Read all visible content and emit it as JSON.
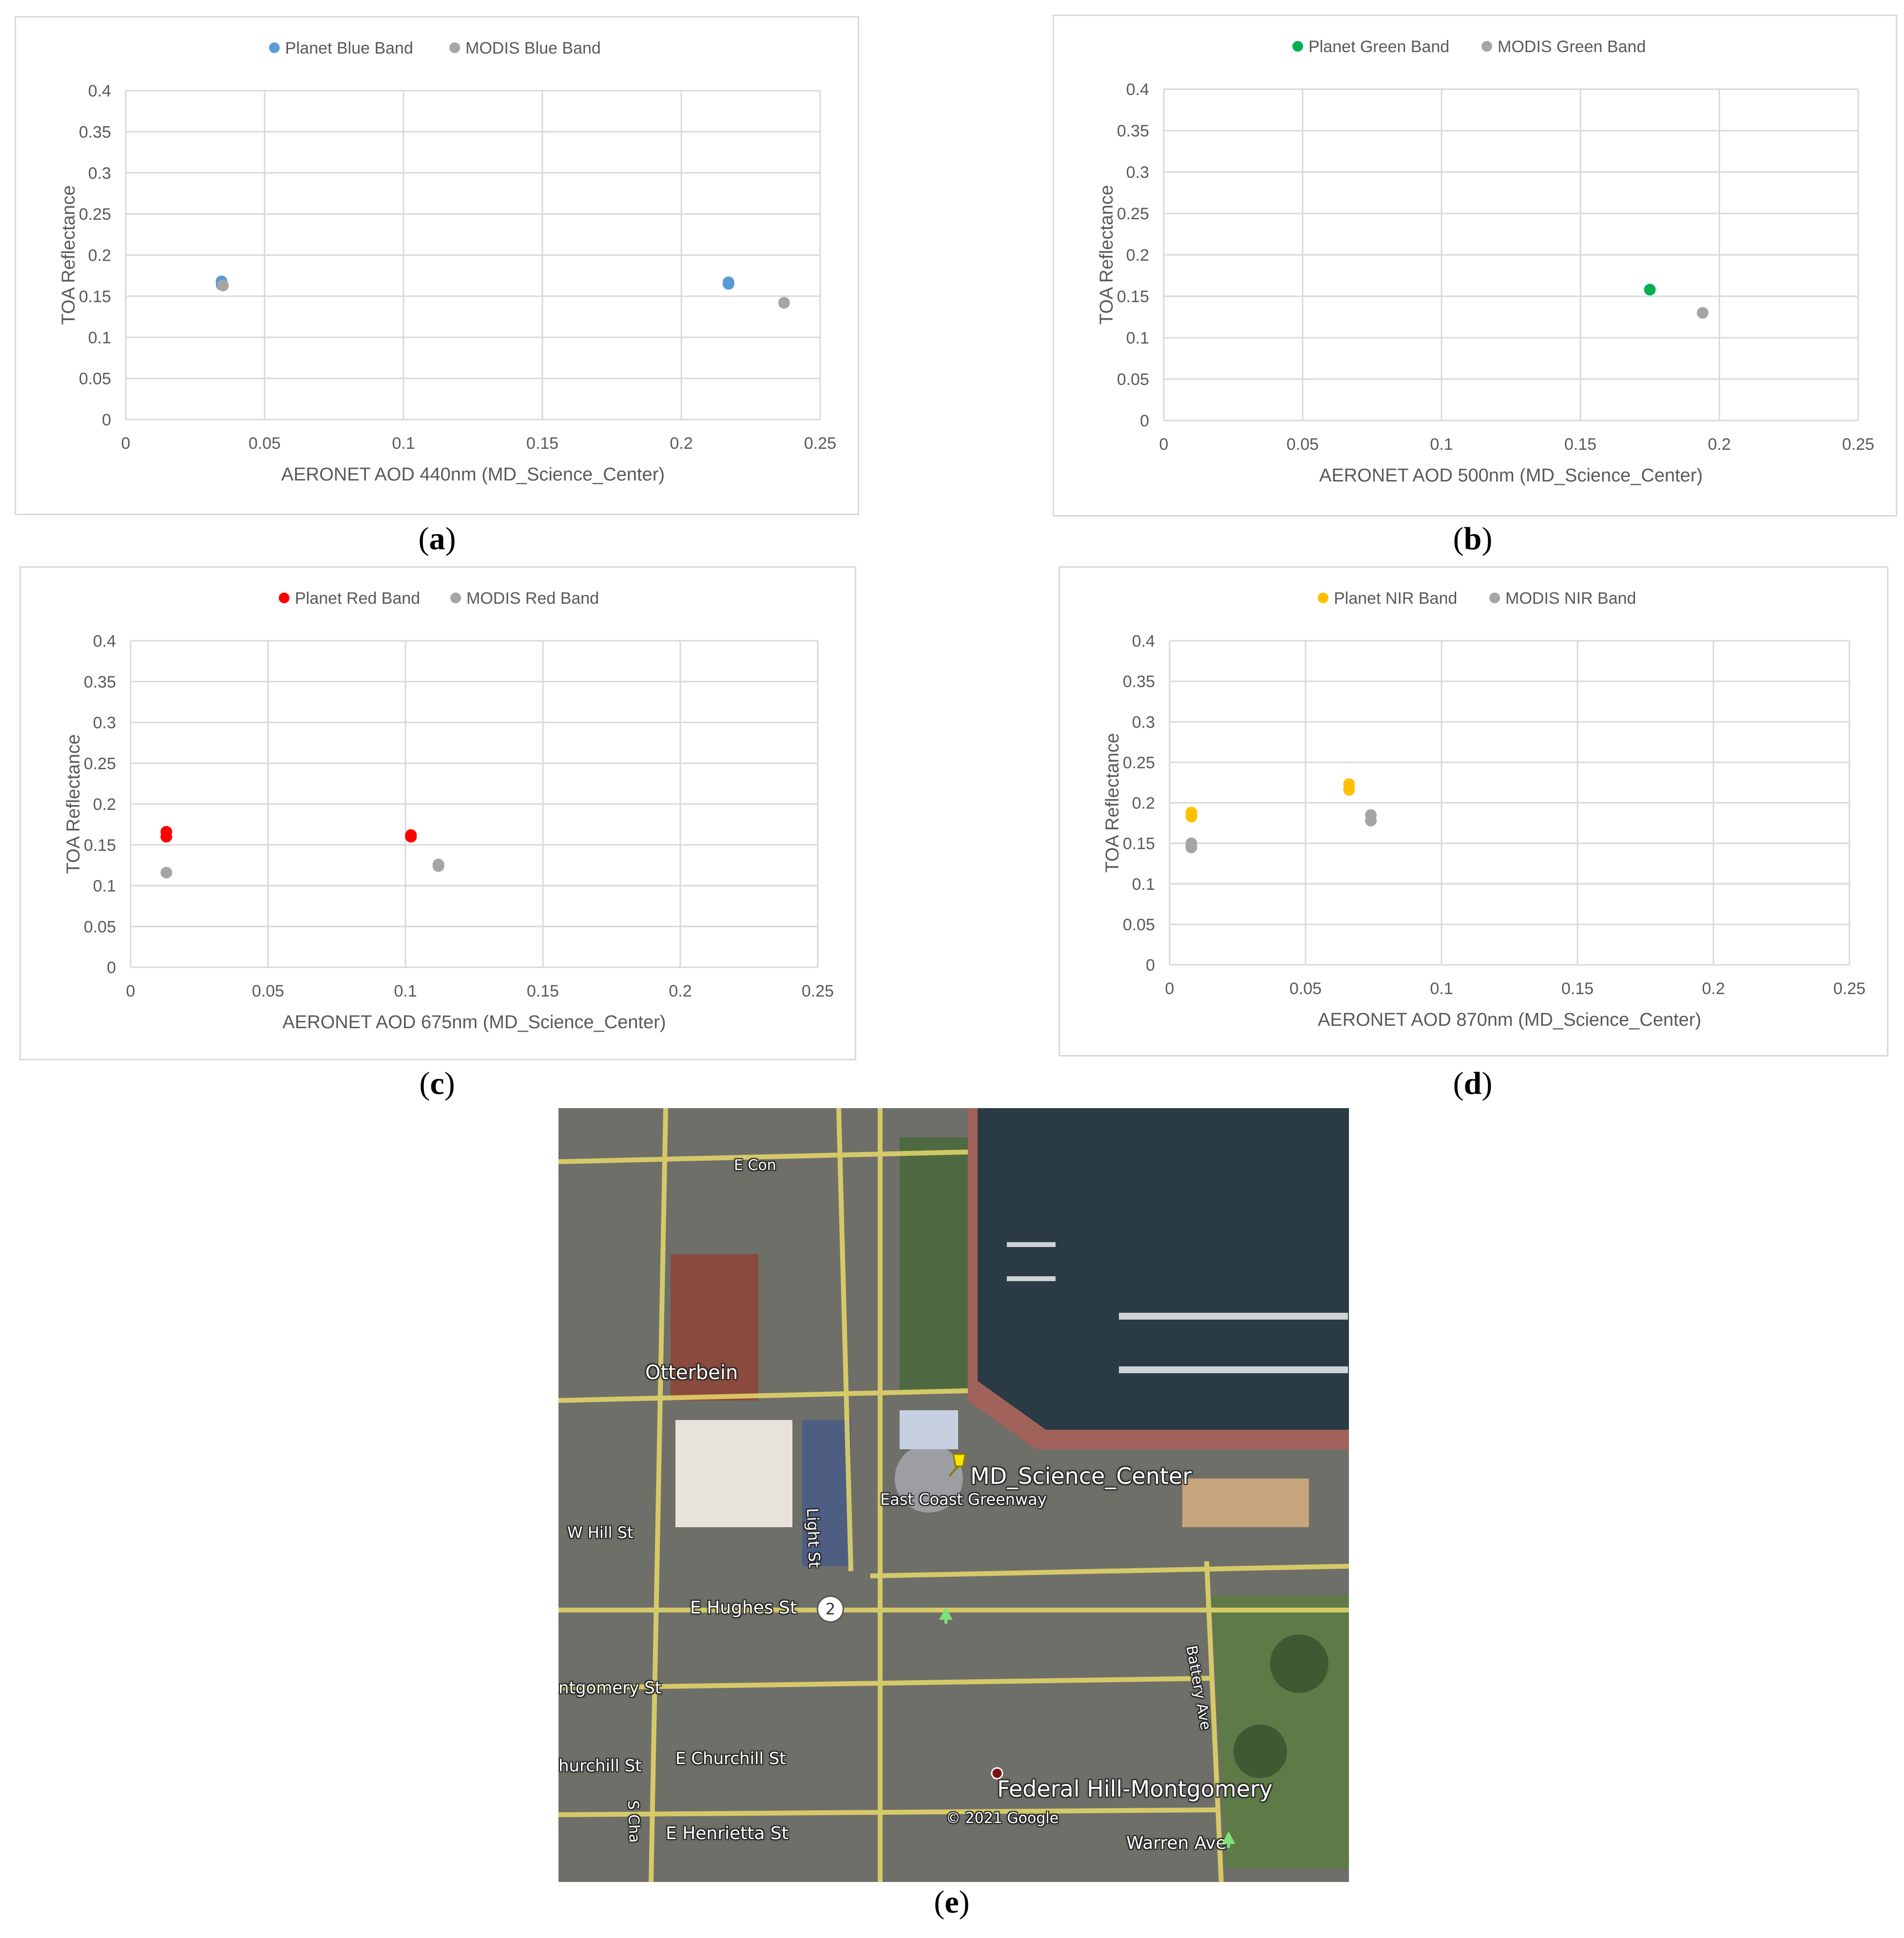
{
  "chart_data": [
    {
      "id": "a",
      "type": "scatter",
      "caption": "a",
      "xlabel": "AERONET AOD 440nm (MD_Science_Center)",
      "ylabel": "TOA Reflectance",
      "xlim": [
        0,
        0.25
      ],
      "ylim": [
        0,
        0.4
      ],
      "xticks": [
        "0",
        "0.05",
        "0.1",
        "0.15",
        "0.2",
        "0.25"
      ],
      "yticks": [
        "0",
        "0.05",
        "0.1",
        "0.15",
        "0.2",
        "0.25",
        "0.3",
        "0.35",
        "0.4"
      ],
      "legend": "top-center",
      "grid": true,
      "series": [
        {
          "name": "Planet Blue Band",
          "color": "#5b9bd5",
          "points": [
            [
              0.0345,
              0.168
            ],
            [
              0.0345,
              0.164
            ],
            [
              0.217,
              0.167
            ],
            [
              0.217,
              0.165
            ]
          ]
        },
        {
          "name": "MODIS Blue Band",
          "color": "#a5a5a5",
          "points": [
            [
              0.035,
              0.163
            ],
            [
              0.237,
              0.142
            ]
          ]
        }
      ]
    },
    {
      "id": "b",
      "type": "scatter",
      "caption": "b",
      "xlabel": "AERONET AOD 500nm (MD_Science_Center)",
      "ylabel": "TOA Reflectance",
      "xlim": [
        0,
        0.25
      ],
      "ylim": [
        0,
        0.4
      ],
      "xticks": [
        "0",
        "0.05",
        "0.1",
        "0.15",
        "0.2",
        "0.25"
      ],
      "yticks": [
        "0",
        "0.05",
        "0.1",
        "0.15",
        "0.2",
        "0.25",
        "0.3",
        "0.35",
        "0.4"
      ],
      "legend": "top-center",
      "grid": true,
      "series": [
        {
          "name": "Planet Green Band",
          "color": "#00b050",
          "points": [
            [
              0.175,
              0.158
            ]
          ]
        },
        {
          "name": "MODIS Green Band",
          "color": "#a5a5a5",
          "points": [
            [
              0.194,
              0.13
            ]
          ]
        }
      ]
    },
    {
      "id": "c",
      "type": "scatter",
      "caption": "c",
      "xlabel": "AERONET AOD 675nm (MD_Science_Center)",
      "ylabel": "TOA Reflectance",
      "xlim": [
        0,
        0.25
      ],
      "ylim": [
        0,
        0.4
      ],
      "xticks": [
        "0",
        "0.05",
        "0.1",
        "0.15",
        "0.2",
        "0.25"
      ],
      "yticks": [
        "0",
        "0.05",
        "0.1",
        "0.15",
        "0.2",
        "0.25",
        "0.3",
        "0.35",
        "0.4"
      ],
      "legend": "top-center",
      "grid": true,
      "series": [
        {
          "name": "Planet Red Band",
          "color": "#ff0000",
          "points": [
            [
              0.013,
              0.166
            ],
            [
              0.013,
              0.16
            ],
            [
              0.102,
              0.162
            ],
            [
              0.102,
              0.16
            ]
          ]
        },
        {
          "name": "MODIS Red Band",
          "color": "#a5a5a5",
          "points": [
            [
              0.013,
              0.116
            ],
            [
              0.112,
              0.126
            ],
            [
              0.112,
              0.124
            ]
          ]
        }
      ]
    },
    {
      "id": "d",
      "type": "scatter",
      "caption": "d",
      "xlabel": "AERONET AOD 870nm (MD_Science_Center)",
      "ylabel": "TOA Reflectance",
      "xlim": [
        0,
        0.25
      ],
      "ylim": [
        0,
        0.4
      ],
      "xticks": [
        "0",
        "0.05",
        "0.1",
        "0.15",
        "0.2",
        "0.25"
      ],
      "yticks": [
        "0",
        "0.05",
        "0.1",
        "0.15",
        "0.2",
        "0.25",
        "0.3",
        "0.35",
        "0.4"
      ],
      "legend": "top-center",
      "grid": true,
      "series": [
        {
          "name": "Planet NIR Band",
          "color": "#ffc000",
          "points": [
            [
              0.008,
              0.188
            ],
            [
              0.008,
              0.183
            ],
            [
              0.066,
              0.223
            ],
            [
              0.066,
              0.216
            ]
          ]
        },
        {
          "name": "MODIS NIR Band",
          "color": "#a5a5a5",
          "points": [
            [
              0.008,
              0.15
            ],
            [
              0.008,
              0.145
            ],
            [
              0.074,
              0.185
            ],
            [
              0.074,
              0.178
            ]
          ]
        }
      ]
    }
  ],
  "map": {
    "caption": "e",
    "labels": {
      "otterbein": "Otterbein",
      "md_science_center": "MD_Science_Center",
      "w_hill_st": "W Hill St",
      "light_st": "Light St",
      "east_coast_greenway": "East Coast Greenway",
      "e_hughes_st": "E Hughes St",
      "montgomery_st": "ntgomery St",
      "churchill_st": "hurchill St",
      "e_churchill_st": "E Churchill St",
      "e_henrietta_st": "E Henrietta St",
      "federal_hill": "Federal Hill-Montgomery",
      "copyright": "© 2021 Google",
      "warren_ave": "Warren Ave",
      "battery_ave": "Battery Ave",
      "route_number": "2",
      "e_conway": "E Con",
      "s_charles": "S Cha"
    },
    "pin_color": "#f7e500"
  }
}
